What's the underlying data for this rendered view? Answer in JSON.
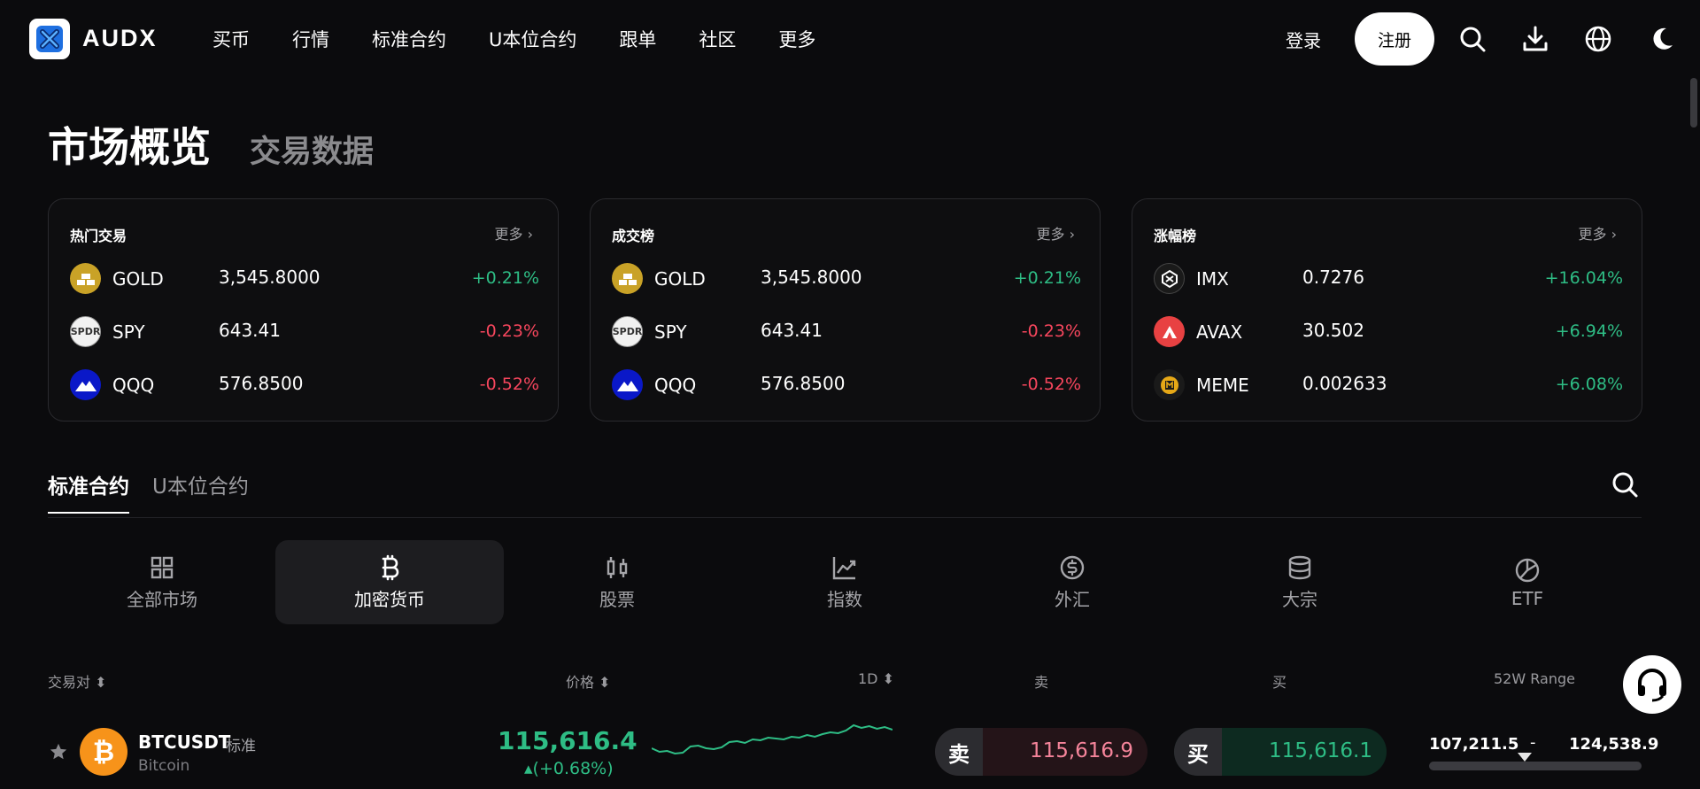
{
  "nav": {
    "brand": "AUDX",
    "items": [
      "买币",
      "行情",
      "标准合约",
      "U本位合约",
      "跟单",
      "社区",
      "更多"
    ],
    "login": "登录",
    "register": "注册"
  },
  "header": {
    "title": "市场概览",
    "subtitle": "交易数据"
  },
  "cards": [
    {
      "title": "热门交易",
      "more": "更多 ›",
      "rows": [
        {
          "symbol": "GOLD",
          "price": "3,545.8000",
          "change": "+0.21%",
          "dir": "up",
          "icon": "gold-icon"
        },
        {
          "symbol": "SPY",
          "price": "643.41",
          "change": "-0.23%",
          "dir": "down",
          "icon": "spdr-icon"
        },
        {
          "symbol": "QQQ",
          "price": "576.8500",
          "change": "-0.52%",
          "dir": "down",
          "icon": "invesco-icon"
        }
      ]
    },
    {
      "title": "成交榜",
      "more": "更多 ›",
      "rows": [
        {
          "symbol": "GOLD",
          "price": "3,545.8000",
          "change": "+0.21%",
          "dir": "up",
          "icon": "gold-icon"
        },
        {
          "symbol": "SPY",
          "price": "643.41",
          "change": "-0.23%",
          "dir": "down",
          "icon": "spdr-icon"
        },
        {
          "symbol": "QQQ",
          "price": "576.8500",
          "change": "-0.52%",
          "dir": "down",
          "icon": "invesco-icon"
        }
      ]
    },
    {
      "title": "涨幅榜",
      "more": "更多 ›",
      "rows": [
        {
          "symbol": "IMX",
          "price": "0.7276",
          "change": "+16.04%",
          "dir": "up",
          "icon": "imx-icon"
        },
        {
          "symbol": "AVAX",
          "price": "30.502",
          "change": "+6.94%",
          "dir": "up",
          "icon": "avax-icon"
        },
        {
          "symbol": "MEME",
          "price": "0.002633",
          "change": "+6.08%",
          "dir": "up",
          "icon": "meme-icon"
        }
      ]
    }
  ],
  "tabs": [
    "标准合约",
    "U本位合约"
  ],
  "categories": [
    {
      "label": "全部市场",
      "icon": "grid-icon"
    },
    {
      "label": "加密货币",
      "icon": "bitcoin-icon"
    },
    {
      "label": "股票",
      "icon": "candlestick-icon"
    },
    {
      "label": "指数",
      "icon": "line-chart-icon"
    },
    {
      "label": "外汇",
      "icon": "dollar-icon"
    },
    {
      "label": "大宗",
      "icon": "database-icon"
    },
    {
      "label": "ETF",
      "icon": "pie-chart-icon"
    }
  ],
  "table": {
    "headers": {
      "pair": "交易对 ⬍",
      "price": "价格 ⬍",
      "period": "1D ⬍",
      "sell": "卖",
      "buy": "买",
      "range": "52W Range"
    },
    "row": {
      "pair": "BTCUSDT",
      "tag": "标准",
      "name": "Bitcoin",
      "price": "115,616.4",
      "change": "▴(+0.68%)",
      "sell_label": "卖",
      "sell_price": "115,616.9",
      "buy_label": "买",
      "buy_price": "115,616.1",
      "range_low": "107,211.5",
      "range_sep": "-",
      "range_high": "124,538.9",
      "range_position": 0.45,
      "sparkline": [
        30,
        34,
        33,
        36,
        35,
        28,
        27,
        30,
        31,
        29,
        23,
        22,
        24,
        20,
        21,
        18,
        19,
        20,
        17,
        18,
        15,
        17,
        14,
        12,
        13,
        10,
        4,
        7,
        5,
        8,
        6,
        9
      ]
    }
  },
  "colors": {
    "up": "#2ebd85",
    "down": "#f6465d"
  }
}
